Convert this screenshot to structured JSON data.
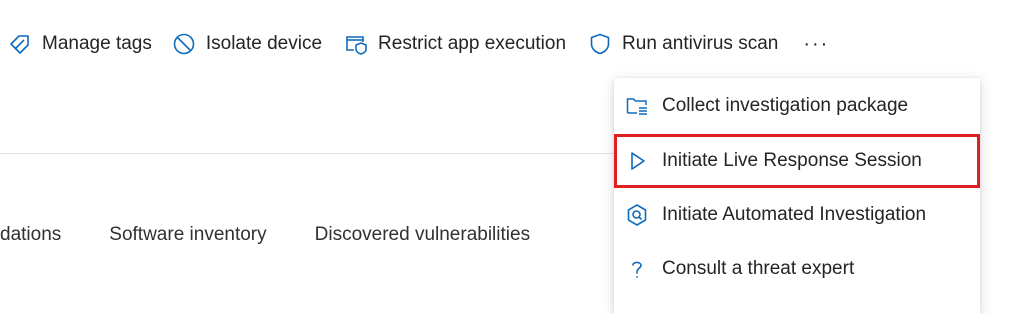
{
  "toolbar": {
    "actions": [
      {
        "label": "Manage tags",
        "icon": "tag-icon"
      },
      {
        "label": "Isolate device",
        "icon": "block-icon"
      },
      {
        "label": "Restrict app execution",
        "icon": "restrict-app-icon"
      },
      {
        "label": "Run antivirus scan",
        "icon": "shield-icon"
      }
    ],
    "more_label": "···"
  },
  "tabs": [
    {
      "label": "dations"
    },
    {
      "label": "Software inventory"
    },
    {
      "label": "Discovered vulnerabilities"
    }
  ],
  "menu": {
    "items": [
      {
        "label": "Collect investigation package",
        "icon": "folder-list-icon"
      },
      {
        "label": "Initiate Live Response Session",
        "icon": "play-icon",
        "highlighted": true
      },
      {
        "label": "Initiate Automated Investigation",
        "icon": "automated-investigation-icon"
      },
      {
        "label": "Consult a threat expert",
        "icon": "question-icon"
      }
    ]
  },
  "colors": {
    "accent": "#0f6cbd",
    "highlight_border": "#e02020",
    "text": "#242424",
    "divider": "#e1dfdd"
  }
}
